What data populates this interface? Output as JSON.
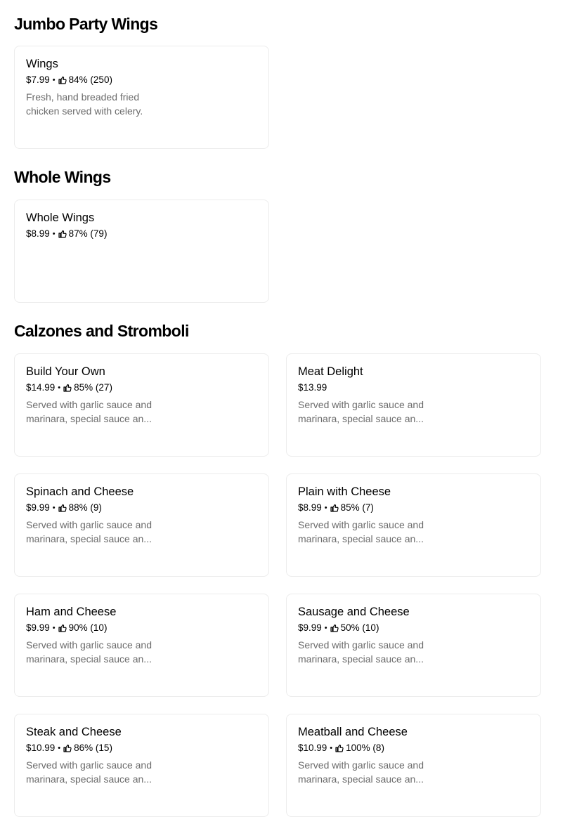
{
  "sections": [
    {
      "title": "Jumbo Party Wings",
      "items": [
        {
          "name": "Wings",
          "price": "$7.99",
          "rating": "84% (250)",
          "description": "Fresh, hand breaded fried chicken served with celery."
        }
      ]
    },
    {
      "title": "Whole Wings",
      "items": [
        {
          "name": "Whole Wings",
          "price": "$8.99",
          "rating": "87% (79)",
          "description": ""
        }
      ]
    },
    {
      "title": "Calzones and Stromboli",
      "items": [
        {
          "name": "Build Your Own",
          "price": "$14.99",
          "rating": "85% (27)",
          "description": "Served with garlic sauce and marinara, special sauce an..."
        },
        {
          "name": "Meat Delight",
          "price": "$13.99",
          "rating": "",
          "description": "Served with garlic sauce and marinara, special sauce an..."
        },
        {
          "name": "Spinach and Cheese",
          "price": "$9.99",
          "rating": "88% (9)",
          "description": "Served with garlic sauce and marinara, special sauce an..."
        },
        {
          "name": "Plain with Cheese",
          "price": "$8.99",
          "rating": "85% (7)",
          "description": "Served with garlic sauce and marinara, special sauce an..."
        },
        {
          "name": "Ham and Cheese",
          "price": "$9.99",
          "rating": "90% (10)",
          "description": "Served with garlic sauce and marinara, special sauce an..."
        },
        {
          "name": "Sausage and Cheese",
          "price": "$9.99",
          "rating": "50% (10)",
          "description": "Served with garlic sauce and marinara, special sauce an..."
        },
        {
          "name": "Steak and Cheese",
          "price": "$10.99",
          "rating": "86% (15)",
          "description": "Served with garlic sauce and marinara, special sauce an..."
        },
        {
          "name": "Meatball and Cheese",
          "price": "$10.99",
          "rating": "100% (8)",
          "description": "Served with garlic sauce and marinara, special sauce an..."
        }
      ]
    }
  ],
  "separator": "•",
  "icons": {
    "rating": "thumbs-up-icon"
  }
}
